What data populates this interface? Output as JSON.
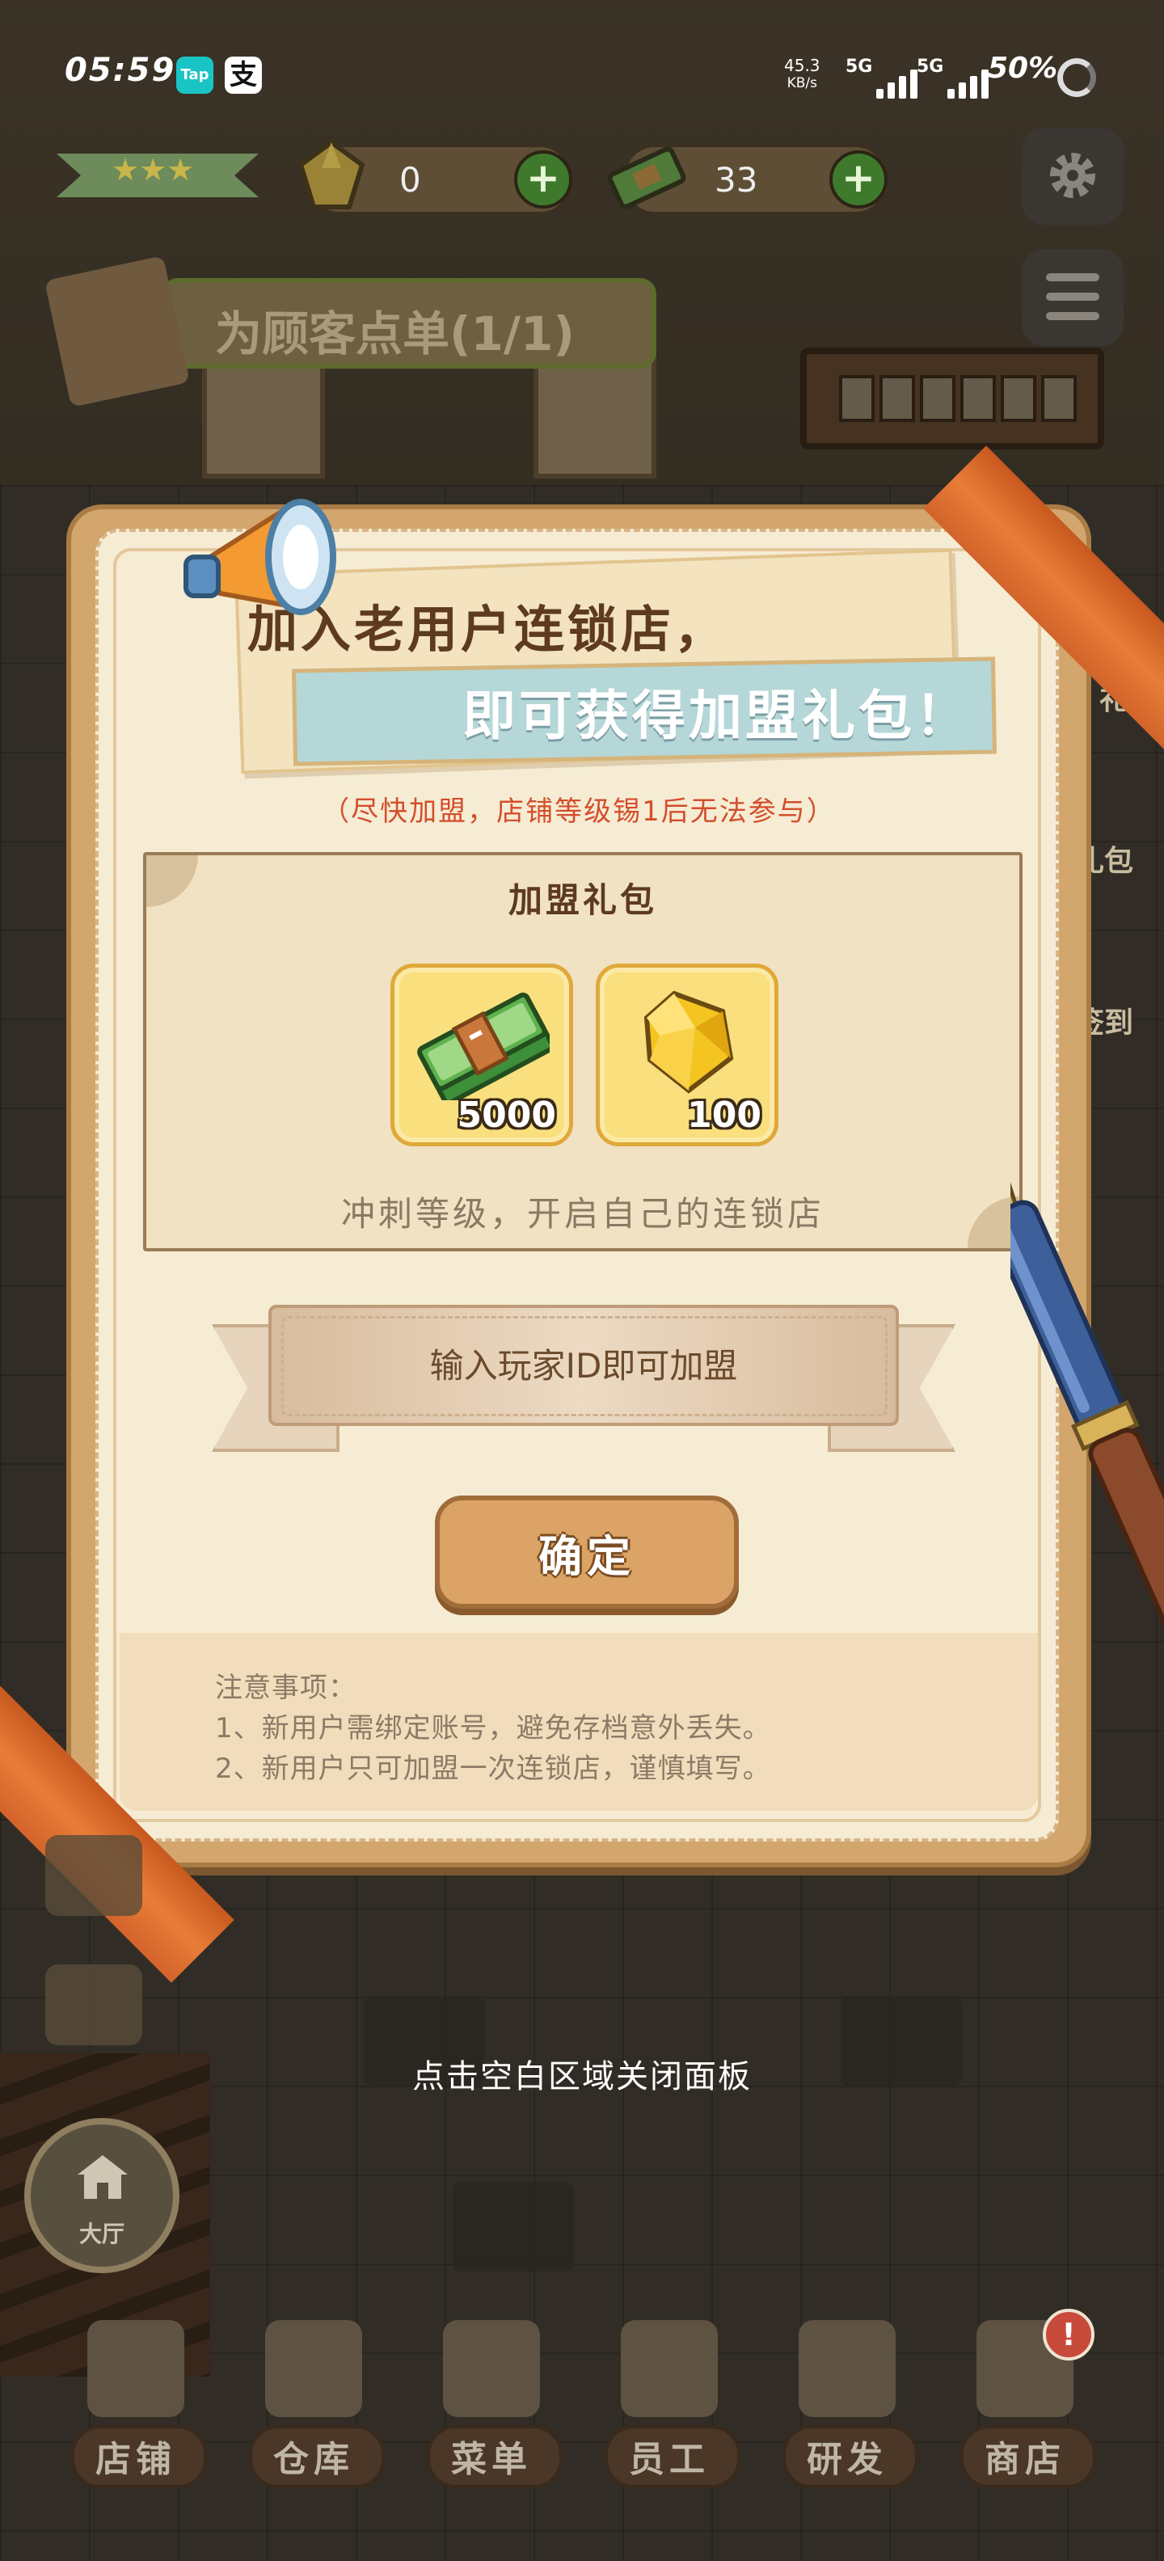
{
  "status_bar": {
    "time": "05:59",
    "app_badge_1": "Tap",
    "app_badge_2": "支",
    "net_speed_value": "45.3",
    "net_speed_unit": "KB/s",
    "signal_1_label": "5G",
    "signal_2_label": "5G",
    "battery": "50%"
  },
  "hud": {
    "gem_count": "0",
    "cash_count": "33",
    "plus_label": "+",
    "quest_label": "为顾客点单(1/1)",
    "side_badges": [
      "福利",
      "礼",
      "礼包",
      "签到"
    ]
  },
  "modal": {
    "title_line1": "加入老用户连锁店，",
    "title_line2": "即可获得加盟礼包！",
    "warning": "（尽快加盟，店铺等级锡1后无法参与）",
    "gift_title": "加盟礼包",
    "rewards": [
      {
        "item": "cash",
        "icon": "cash-stack-icon",
        "quantity": "5000"
      },
      {
        "item": "gem",
        "icon": "gem-icon",
        "quantity": "100"
      }
    ],
    "gift_subtitle": "冲刺等级，开启自己的连锁店",
    "id_input": {
      "placeholder": "输入玩家ID即可加盟",
      "value": ""
    },
    "confirm_label": "确定",
    "notes_title": "注意事项：",
    "notes": [
      "1、新用户需绑定账号，避免存档意外丢失。",
      "2、新用户只可加盟一次连锁店，谨慎填写。"
    ]
  },
  "close_hint": "点击空白区域关闭面板",
  "hall_label": "大厅",
  "bottom_nav": [
    {
      "label": "店铺",
      "icon": "shop-icon"
    },
    {
      "label": "仓库",
      "icon": "warehouse-icon"
    },
    {
      "label": "菜单",
      "icon": "menu-clipboard-icon"
    },
    {
      "label": "员工",
      "icon": "staff-icon"
    },
    {
      "label": "研发",
      "icon": "cooking-pot-icon"
    },
    {
      "label": "商店",
      "icon": "store-icon"
    }
  ],
  "store_alert": "!",
  "colors": {
    "modal_frame": "#d2a66c",
    "modal_paper": "#f6ecd4",
    "accent_orange": "#e87d37",
    "warning_text": "#d44e2c",
    "confirm_button": "#dba365",
    "reward_tile": "#f9df7d"
  }
}
